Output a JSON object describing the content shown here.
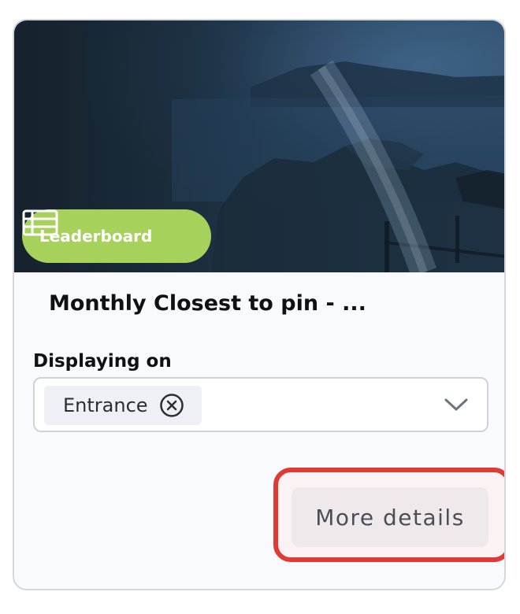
{
  "card": {
    "badge_label": "Leaderboard",
    "badge_icon": "list-table-icon",
    "badge_color": "#a6d15a",
    "title": "Monthly Closest to pin - ...",
    "display_label": "Displaying on",
    "selected_chips": [
      {
        "label": "Entrance",
        "remove_icon": "circle-x-icon"
      }
    ],
    "dropdown_icon": "chevron-down-icon",
    "more_button_label": "More details",
    "highlight_color": "#e03a34"
  }
}
